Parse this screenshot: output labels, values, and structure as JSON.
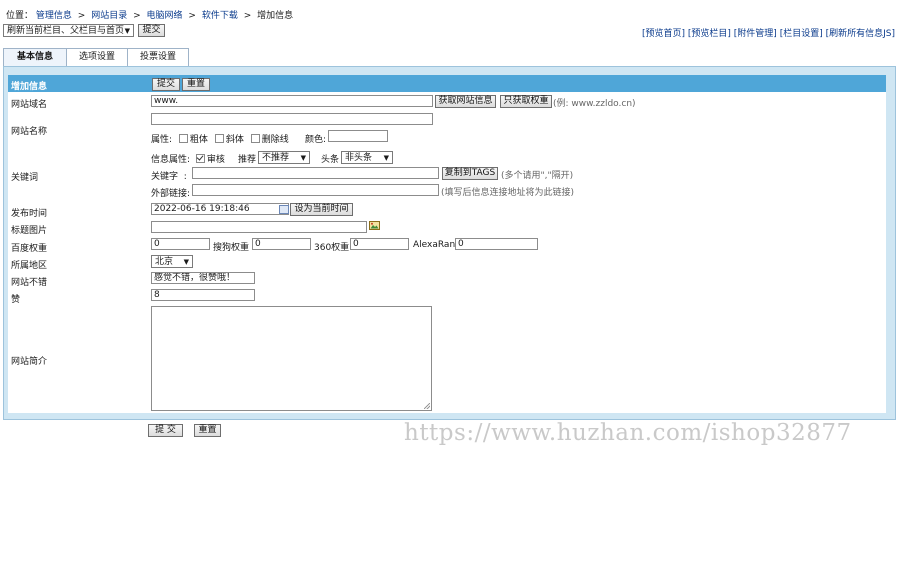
{
  "breadcrumb": {
    "prefix": "位置：",
    "items": [
      "管理信息",
      "网站目录",
      "电脑网络",
      "软件下载"
    ],
    "current": "增加信息",
    "separator": ">"
  },
  "toolbar": {
    "refresh_select": "刷新当前栏目、父栏目与首页",
    "submit_label": "提交",
    "links": [
      "[预览首页]",
      "[预览栏目]",
      "[附件管理]",
      "[栏目设置]",
      "[刷新所有信息JS]"
    ]
  },
  "tabs": [
    "基本信息",
    "选项设置",
    "投票设置"
  ],
  "form": {
    "header": "增加信息",
    "header_submit": "提交",
    "header_reset": "重置",
    "site_domain": {
      "label": "网站域名",
      "value": "www.",
      "fetch_info_btn": "获取网站信息",
      "fetch_weight_btn": "只获取权重",
      "hint": "(例: www.zzldo.cn)"
    },
    "site_name": {
      "label": "网站名称",
      "value": "",
      "attr_label": "属性:",
      "bold": "粗体",
      "italic": "斜体",
      "strike": "删除线",
      "color_label": "颜色:",
      "info_attr_label": "信息属性:",
      "audit": "审核",
      "audit_checked": true,
      "recommend_label": "推荐",
      "recommend_value": "不推荐",
      "headline_label": "头条",
      "headline_value": "非头条"
    },
    "keywords": {
      "label": "关键词",
      "kw_label": "关键字",
      "kw_value": "",
      "copy_tags_btn": "复制到TAGS",
      "kw_hint": "(多个请用\",\"隔开)",
      "ext_label": "外部链接:",
      "ext_value": "",
      "ext_hint": "(填写后信息连接地址将为此链接)"
    },
    "publish_time": {
      "label": "发布时间",
      "value": "2022-06-16 19:18:46",
      "set_now_btn": "设为当前时间"
    },
    "title_image": {
      "label": "标题图片",
      "value": ""
    },
    "baidu_weight": {
      "label": "百度权重",
      "value": "0",
      "sogou_label": "搜狗权重",
      "sogou_value": "0",
      "s360_label": "360权重",
      "s360_value": "0",
      "alexa_label": "AlexaRank",
      "alexa_value": "0"
    },
    "region": {
      "label": "所属地区",
      "value": "北京"
    },
    "site_good": {
      "label": "网站不错",
      "value": "感觉不错，很赞哦！"
    },
    "likes": {
      "label": "赞",
      "value": "8"
    },
    "intro": {
      "label": "网站简介",
      "value": ""
    },
    "bottom_submit": "提 交",
    "bottom_reset": "重置"
  },
  "watermark": "https://www.huzhan.com/ishop32877"
}
